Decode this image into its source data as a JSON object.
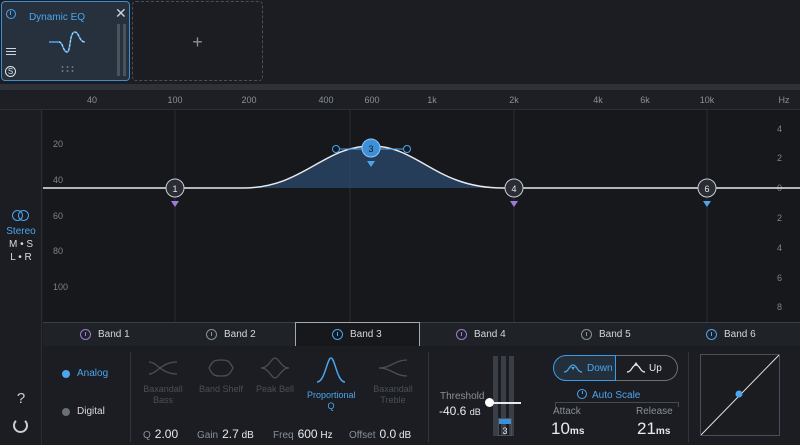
{
  "module": {
    "title": "Dynamic EQ",
    "close_glyph": "✕",
    "solo_glyph": "S"
  },
  "slot": {
    "add_glyph": "+"
  },
  "ruler": {
    "labels": [
      "40",
      "100",
      "200",
      "400",
      "600",
      "1k",
      "2k",
      "4k",
      "6k",
      "10k",
      "Hz"
    ]
  },
  "left": {
    "stereo": "Stereo",
    "ms": "M • S",
    "lr": "L • R",
    "help": "?"
  },
  "graph": {
    "left_scale": [
      "20",
      "40",
      "60",
      "80",
      "100"
    ],
    "right_scale": [
      "4",
      "2",
      "0",
      "2",
      "4",
      "6",
      "8"
    ],
    "nodes": [
      "1",
      "3",
      "4",
      "6"
    ]
  },
  "tabs": [
    "Band 1",
    "Band 2",
    "Band 3",
    "Band 4",
    "Band 5",
    "Band 6"
  ],
  "active_tab": "Band 3",
  "mode": {
    "analog": "Analog",
    "digital": "Digital",
    "selected": "Analog"
  },
  "shapes": [
    "Baxandall Bass",
    "Band Shelf",
    "Peak Bell",
    "Proportional Q",
    "Baxandall Treble"
  ],
  "active_shape": "Proportional Q",
  "params": {
    "q_label": "Q",
    "q_value": "2.00",
    "gain_label": "Gain",
    "gain_value": "2.7",
    "gain_unit": "dB",
    "freq_label": "Freq",
    "freq_value": "600",
    "freq_unit": "Hz",
    "offset_label": "Offset",
    "offset_value": "0.0",
    "offset_unit": "dB"
  },
  "threshold": {
    "label": "Threshold",
    "value": "-40.6",
    "unit": "dB",
    "band_badge": "3"
  },
  "direction": {
    "down": "Down",
    "up": "Up",
    "selected": "Down"
  },
  "autoscale": "Auto Scale",
  "attack": {
    "label": "Attack",
    "value": "10",
    "unit": "ms"
  },
  "release": {
    "label": "Release",
    "value": "21",
    "unit": "ms"
  },
  "colors": {
    "accent": "#4ba6ee",
    "band1": "#a07ad8",
    "band4": "#a07ad8",
    "band6": "#4ba6ee"
  }
}
